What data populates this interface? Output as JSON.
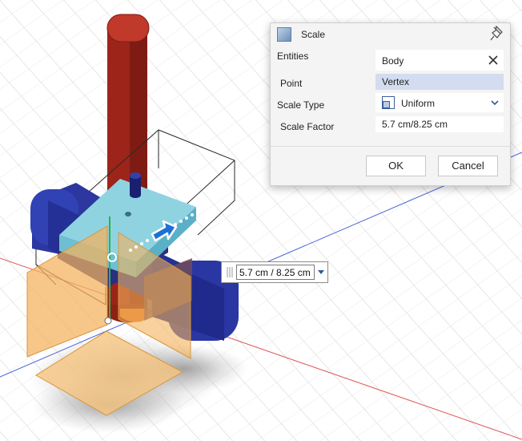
{
  "dialog": {
    "title": "Scale",
    "icon": "scale-tool-icon",
    "rows": {
      "entities": {
        "label": "Entities",
        "value": "Body"
      },
      "point": {
        "label": "Point",
        "value": "Vertex"
      },
      "scale_type": {
        "label": "Scale Type",
        "value": "Uniform"
      },
      "scale_factor": {
        "label": "Scale Factor",
        "value": "5.7 cm/8.25 cm"
      }
    },
    "ok_label": "OK",
    "cancel_label": "Cancel"
  },
  "floating_input": {
    "value": "5.7 cm / 8.25 cm"
  },
  "colors": {
    "accent": "#2c5aa0",
    "body_blue": "#2d3aa8",
    "top_face": "#8ed3e0",
    "pillar_red": "#a82a1f",
    "plane_orange": "#f2b25e",
    "selection": "#d3dcf0"
  }
}
